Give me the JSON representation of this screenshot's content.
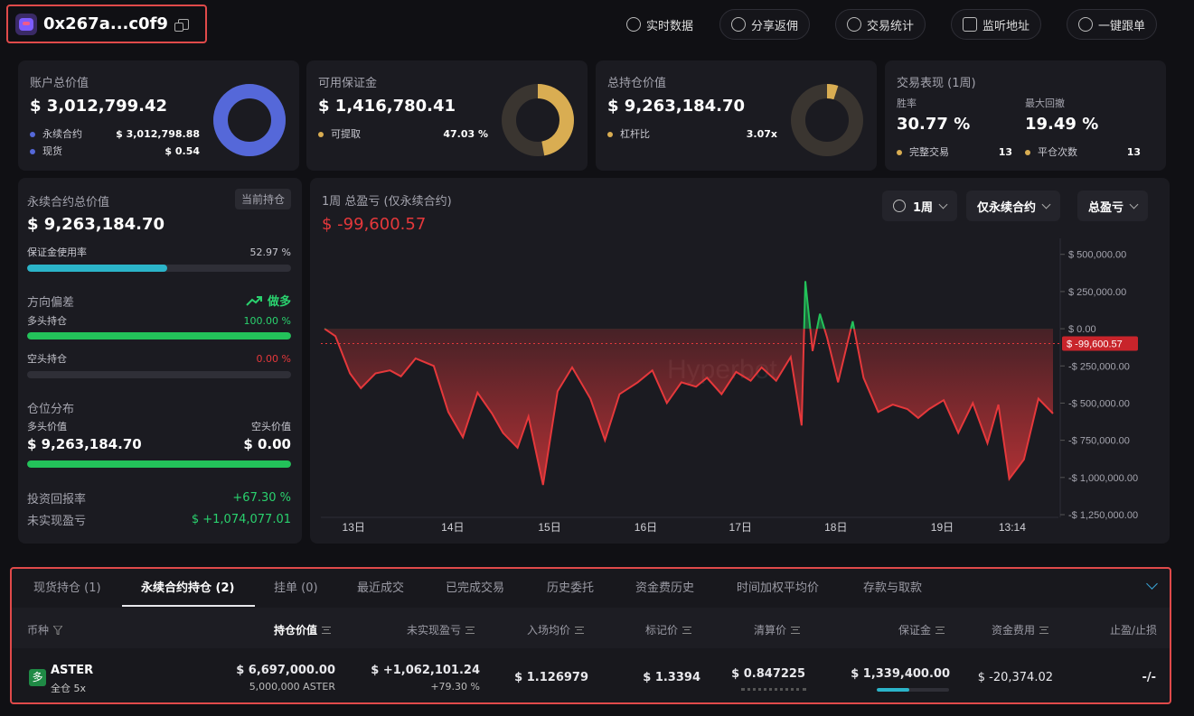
{
  "header": {
    "address": "0x267a...c0f9",
    "buttons": [
      {
        "label": "实时数据",
        "icon": "refresh-icon"
      },
      {
        "label": "分享返佣",
        "icon": "share-icon"
      },
      {
        "label": "交易统计",
        "icon": "stats-icon"
      },
      {
        "label": "监听地址",
        "icon": "monitor-icon"
      },
      {
        "label": "一键跟单",
        "icon": "copy-trade-icon"
      }
    ]
  },
  "cards": {
    "account": {
      "title": "账户总价值",
      "value": "$ 3,012,799.42",
      "perp_label": "永续合约",
      "perp_value": "$ 3,012,798.88",
      "spot_label": "现货",
      "spot_value": "$ 0.54",
      "donut_fraction": 0.9999,
      "color": "#5568d9"
    },
    "margin": {
      "title": "可用保证金",
      "value": "$ 1,416,780.41",
      "withdraw_label": "可提取",
      "withdraw_value": "47.03 %",
      "donut_fraction": 0.4703,
      "color": "#d9ad52"
    },
    "position": {
      "title": "总持仓价值",
      "value": "$ 9,263,184.70",
      "leverage_label": "杠杆比",
      "leverage_value": "3.07x",
      "donut_fraction": 0.05,
      "color": "#d9ad52"
    },
    "performance": {
      "title": "交易表现 (1周)",
      "winrate_label": "胜率",
      "winrate_value": "30.77 %",
      "drawdown_label": "最大回撤",
      "drawdown_value": "19.49 %",
      "complete_label": "完整交易",
      "complete_value": "13",
      "close_label": "平仓次数",
      "close_value": "13"
    }
  },
  "left_panel": {
    "title": "永续合约总价值",
    "badge": "当前持仓",
    "value": "$ 9,263,184.70",
    "margin_rate_label": "保证金使用率",
    "margin_rate_value": "52.97 %",
    "margin_rate": 0.5297,
    "bias_label": "方向偏差",
    "bias_value": "做多",
    "long_label": "多头持仓",
    "long_value": "100.00 %",
    "long_rate": 1.0,
    "short_label": "空头持仓",
    "short_value": "0.00 %",
    "short_rate": 0.0,
    "dist_label": "仓位分布",
    "long_val_label": "多头价值",
    "short_val_label": "空头价值",
    "long_val": "$ 9,263,184.70",
    "short_val": "$ 0.00",
    "roi_label": "投资回报率",
    "roi_value": "+67.30 %",
    "upnl_label": "未实现盈亏",
    "upnl_value": "$ +1,074,077.01"
  },
  "pnl_panel": {
    "title": "1周 总盈亏 (仅永续合约)",
    "value": "$ -99,600.57",
    "filters": [
      "1周",
      "仅永续合约",
      "总盈亏"
    ],
    "watermark": "Hyperbot"
  },
  "chart_data": {
    "type": "line",
    "x_ticks": [
      "13日",
      "14日",
      "15日",
      "16日",
      "17日",
      "18日",
      "19日",
      "13:14"
    ],
    "y_ticks": [
      "$ 500,000.00",
      "$ 250,000.00",
      "$ 0.00",
      "-$ 250,000.00",
      "-$ 500,000.00",
      "-$ 750,000.00",
      "-$ 1,000,000.00",
      "-$ 1,250,000.00"
    ],
    "y_tick_values": [
      500000,
      250000,
      0,
      -250000,
      -500000,
      -750000,
      -1000000,
      -1250000
    ],
    "current_label": "$ -99,600.57",
    "current_value": -99600.57,
    "ylim": [
      -1250000,
      650000
    ],
    "x_range": [
      0,
      100
    ],
    "x_tick_positions": [
      4,
      17.6,
      30.9,
      44.1,
      57.1,
      70.2,
      84.8,
      94.4
    ],
    "points": [
      [
        0,
        0
      ],
      [
        1.5,
        -50000
      ],
      [
        3.5,
        -300000
      ],
      [
        5,
        -400000
      ],
      [
        7,
        -300000
      ],
      [
        9,
        -280000
      ],
      [
        10.5,
        -320000
      ],
      [
        12.5,
        -200000
      ],
      [
        15,
        -250000
      ],
      [
        17,
        -560000
      ],
      [
        19,
        -730000
      ],
      [
        21,
        -430000
      ],
      [
        23,
        -570000
      ],
      [
        24.5,
        -700000
      ],
      [
        26.5,
        -800000
      ],
      [
        28,
        -590000
      ],
      [
        30,
        -1050000
      ],
      [
        32,
        -420000
      ],
      [
        34,
        -260000
      ],
      [
        36.5,
        -470000
      ],
      [
        38.5,
        -750000
      ],
      [
        40.5,
        -440000
      ],
      [
        43,
        -360000
      ],
      [
        45,
        -280000
      ],
      [
        47,
        -500000
      ],
      [
        49,
        -360000
      ],
      [
        51,
        -390000
      ],
      [
        52.5,
        -330000
      ],
      [
        54.5,
        -440000
      ],
      [
        56.5,
        -290000
      ],
      [
        58.5,
        -350000
      ],
      [
        60,
        -260000
      ],
      [
        62,
        -350000
      ],
      [
        64,
        -190000
      ],
      [
        65.5,
        -650000
      ],
      [
        66,
        320000
      ],
      [
        67,
        -150000
      ],
      [
        68,
        100000
      ],
      [
        69,
        -60000
      ],
      [
        70.5,
        -360000
      ],
      [
        72.5,
        50000
      ],
      [
        74,
        -330000
      ],
      [
        76,
        -560000
      ],
      [
        78,
        -510000
      ],
      [
        80,
        -540000
      ],
      [
        81.5,
        -600000
      ],
      [
        83,
        -540000
      ],
      [
        85,
        -480000
      ],
      [
        87,
        -700000
      ],
      [
        89,
        -500000
      ],
      [
        91,
        -770000
      ],
      [
        92.5,
        -510000
      ],
      [
        94,
        -1010000
      ],
      [
        96,
        -880000
      ],
      [
        98,
        -470000
      ],
      [
        100,
        -570000
      ]
    ]
  },
  "tabs": [
    "现货持仓 (1)",
    "永续合约持仓 (2)",
    "挂单 (0)",
    "最近成交",
    "已完成交易",
    "历史委托",
    "资金费历史",
    "时间加权平均价",
    "存款与取款"
  ],
  "table": {
    "headers": [
      "币种",
      "持仓价值",
      "未实现盈亏",
      "入场均价",
      "标记价",
      "清算价",
      "保证金",
      "资金费用",
      "止盈/止损"
    ],
    "rows": [
      {
        "side": "多",
        "coin": "ASTER",
        "mode": "全仓 5x",
        "value": "$ 6,697,000.00",
        "value_sub": "5,000,000 ASTER",
        "upnl": "$ +1,062,101.24",
        "upnl_pct": "+79.30 %",
        "entry": "$ 1.126979",
        "mark": "$ 1.3394",
        "liq": "$ 0.847225",
        "margin": "$ 1,339,400.00",
        "margin_ratio": 0.45,
        "funding": "$ -20,374.02",
        "tpsl": "-/-"
      }
    ]
  }
}
